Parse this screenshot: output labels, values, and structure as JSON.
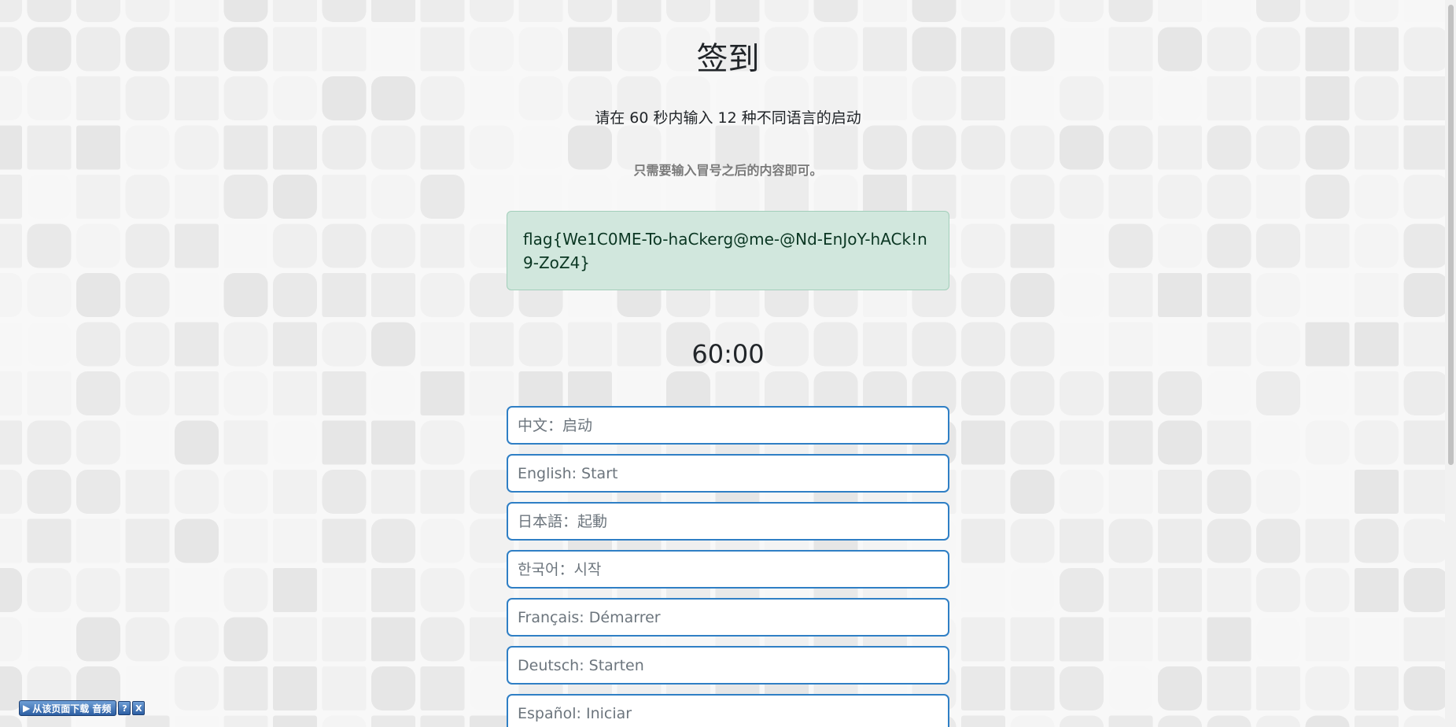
{
  "page": {
    "title": "签到",
    "subtitle": "请在 60 秒内输入 12 种不同语言的启动",
    "hint": "只需要输入冒号之后的内容即可。",
    "flag": "flag{We1C0ME-To-haCkerg@me-@Nd-EnJoY-hACk!n9-ZoZ4}",
    "timer": "60:00"
  },
  "inputs": [
    {
      "placeholder": "中文：启动",
      "value": ""
    },
    {
      "placeholder": "English: Start",
      "value": ""
    },
    {
      "placeholder": "日本語：起動",
      "value": ""
    },
    {
      "placeholder": "한국어：시작",
      "value": ""
    },
    {
      "placeholder": "Français: Démarrer",
      "value": ""
    },
    {
      "placeholder": "Deutsch: Starten",
      "value": ""
    },
    {
      "placeholder": "Español: Iniciar",
      "value": ""
    }
  ],
  "download_bar": {
    "label": "从该页面下载 音频",
    "help_label": "?",
    "close_label": "X",
    "play_icon": "play-icon"
  },
  "colors": {
    "success_bg": "#d1e7dd",
    "input_border": "#2f7fc5",
    "background": "#f8f8f8"
  }
}
